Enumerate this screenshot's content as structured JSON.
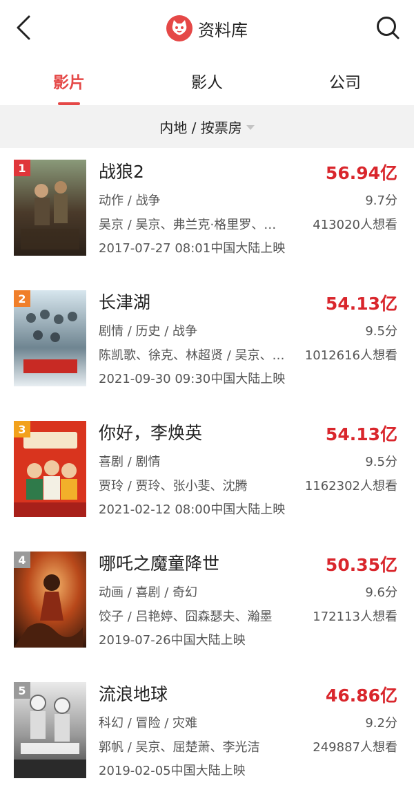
{
  "header": {
    "title": "资料库",
    "back_icon": "chevron-left-icon",
    "search_icon": "search-icon",
    "logo_icon": "cat-logo-icon",
    "brand_color": "#e54847"
  },
  "tabs": [
    {
      "label": "影片",
      "active": true
    },
    {
      "label": "影人",
      "active": false
    },
    {
      "label": "公司",
      "active": false
    }
  ],
  "filter": {
    "label": "内地 / 按票房"
  },
  "movies": [
    {
      "rank": "1",
      "rank_color": "#e0363a",
      "title": "战狼2",
      "box_office": "56.94亿",
      "genres": "动作 / 战争",
      "score": "9.7分",
      "cast": "吴京 / 吴京、弗兰克·格里罗、吴刚",
      "want": "413020人想看",
      "release": "2017-07-27 08:01中国大陆上映",
      "poster_colors": [
        "#6b7a5a",
        "#3a2e22",
        "#a88a62"
      ]
    },
    {
      "rank": "2",
      "rank_color": "#f07f2a",
      "title": "长津湖",
      "box_office": "54.13亿",
      "genres": "剧情 / 历史 / 战争",
      "score": "9.5分",
      "cast": "陈凯歌、徐克、林超贤 / 吴京、易烊千玺",
      "want": "1012616人想看",
      "release": "2021-09-30 09:30中国大陆上映",
      "poster_colors": [
        "#bcd2df",
        "#5c6e78",
        "#2f3b44"
      ]
    },
    {
      "rank": "3",
      "rank_color": "#f2a11c",
      "title": "你好，李焕英",
      "box_office": "54.13亿",
      "genres": "喜剧 / 剧情",
      "score": "9.5分",
      "cast": "贾玲 / 贾玲、张小斐、沈腾",
      "want": "1162302人想看",
      "release": "2021-02-12 08:00中国大陆上映",
      "poster_colors": [
        "#d9341e",
        "#f0b02a",
        "#7a1a12"
      ]
    },
    {
      "rank": "4",
      "rank_color": "#9a9a9a",
      "title": "哪吒之魔童降世",
      "box_office": "50.35亿",
      "genres": "动画 / 喜剧 / 奇幻",
      "score": "9.6分",
      "cast": "饺子 / 吕艳婷、囧森瑟夫、瀚墨",
      "want": "172113人想看",
      "release": "2019-07-26中国大陆上映",
      "poster_colors": [
        "#3b1d10",
        "#c2551c",
        "#f0a35a"
      ]
    },
    {
      "rank": "5",
      "rank_color": "#9a9a9a",
      "title": "流浪地球",
      "box_office": "46.86亿",
      "genres": "科幻 / 冒险 / 灾难",
      "score": "9.2分",
      "cast": "郭帆 / 吴京、屈楚萧、李光洁",
      "want": "249887人想看",
      "release": "2019-02-05中国大陆上映",
      "poster_colors": [
        "#d8d8d8",
        "#7d7d7d",
        "#3a3a3a"
      ]
    }
  ]
}
